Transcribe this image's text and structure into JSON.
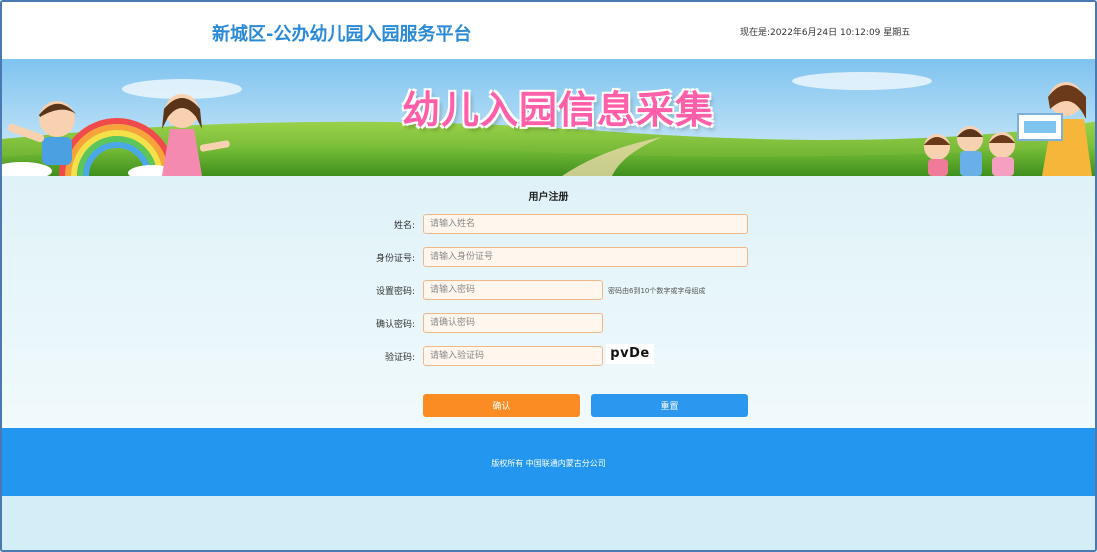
{
  "header": {
    "site_title": "新城区-公办幼儿园入园服务平台",
    "clock": "现在是:2022年6月24日 10:12:09 星期五"
  },
  "banner": {
    "title": "幼儿入园信息采集"
  },
  "form": {
    "title": "用户注册",
    "fields": [
      {
        "label": "姓名:",
        "placeholder": "请输入姓名",
        "value": ""
      },
      {
        "label": "身份证号:",
        "placeholder": "请输入身份证号",
        "value": ""
      },
      {
        "label": "设置密码:",
        "placeholder": "请输入密码",
        "value": "",
        "hint": "密码由6到10个数字或字母组成"
      },
      {
        "label": "确认密码:",
        "placeholder": "请确认密码",
        "value": ""
      },
      {
        "label": "验证码:",
        "placeholder": "请输入验证码",
        "value": "",
        "captcha": "pvDe"
      }
    ],
    "confirm_label": "确认",
    "reset_label": "重置"
  },
  "footer": {
    "text": "版权所有 中国联通内蒙古分公司"
  },
  "colors": {
    "title_blue": "#2a8ad6",
    "confirm_orange": "#fb8c23",
    "reset_blue": "#2b97ee",
    "footer_blue": "#2397f0"
  }
}
